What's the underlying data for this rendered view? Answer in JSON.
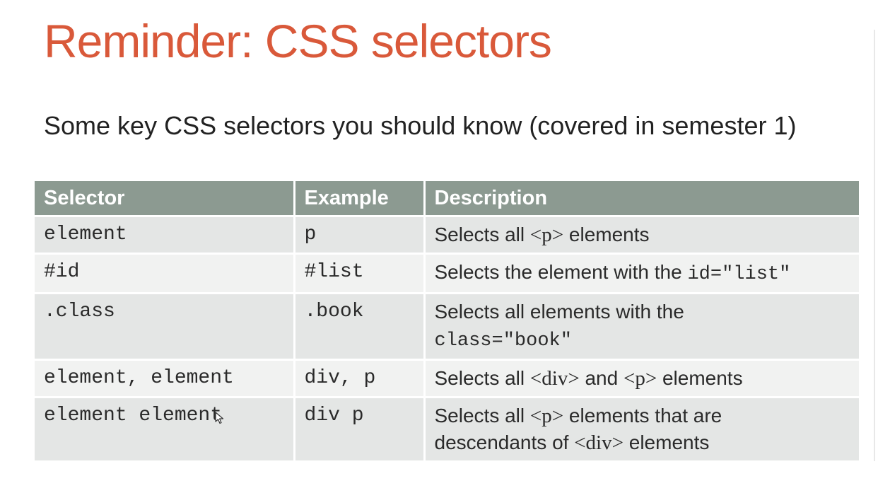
{
  "slide": {
    "title": "Reminder: CSS selectors",
    "subtitle": "Some key CSS selectors you should know (covered in semester 1)"
  },
  "table": {
    "headers": [
      "Selector",
      "Example",
      "Description"
    ],
    "rows": [
      {
        "selector": "element",
        "example": "p",
        "description": [
          {
            "t": "text",
            "v": "Selects all "
          },
          {
            "t": "serif",
            "v": "<p>"
          },
          {
            "t": "text",
            "v": " elements"
          }
        ]
      },
      {
        "selector": "#id",
        "example": "#list",
        "description": [
          {
            "t": "text",
            "v": "Selects the element with the "
          },
          {
            "t": "code",
            "v": "id=\"list\""
          }
        ]
      },
      {
        "selector": ".class",
        "example": ".book",
        "description": [
          {
            "t": "text",
            "v": "Selects all elements with the "
          },
          {
            "t": "br",
            "v": ""
          },
          {
            "t": "code",
            "v": "class=\"book\""
          }
        ]
      },
      {
        "selector": "element, element",
        "example": "div, p",
        "description": [
          {
            "t": "text",
            "v": "Selects all "
          },
          {
            "t": "serif",
            "v": "<div>"
          },
          {
            "t": "text",
            "v": " and "
          },
          {
            "t": "serif",
            "v": "<p>"
          },
          {
            "t": "text",
            "v": " elements"
          }
        ]
      },
      {
        "selector": "element element",
        "example": "div p",
        "description": [
          {
            "t": "text",
            "v": "Selects all "
          },
          {
            "t": "serif",
            "v": "<p>"
          },
          {
            "t": "text",
            "v": " elements that are "
          },
          {
            "t": "br",
            "v": ""
          },
          {
            "t": "text",
            "v": "descendants of "
          },
          {
            "t": "serif",
            "v": "<div>"
          },
          {
            "t": "text",
            "v": " elements"
          }
        ]
      }
    ]
  },
  "colors": {
    "title": "#d9593a",
    "header_bg": "#8c9a91",
    "row_odd": "#e4e6e5",
    "row_even": "#f1f2f1"
  },
  "icons": {
    "cursor": "mouse-pointer-icon"
  }
}
